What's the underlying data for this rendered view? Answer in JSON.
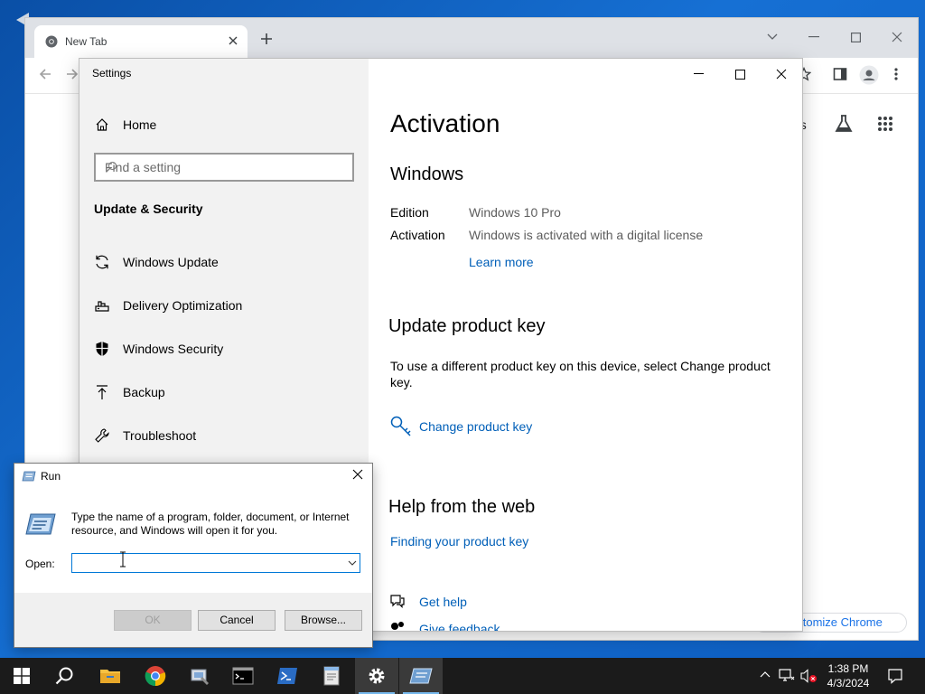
{
  "chrome": {
    "tab_title": "New Tab",
    "ntp_shortcut_fragment": "es",
    "customize_label": "ustomize Chrome"
  },
  "settings": {
    "window_title": "Settings",
    "home_label": "Home",
    "search_placeholder": "Find a setting",
    "group_title": "Update & Security",
    "nav_items": [
      {
        "label": "Windows Update",
        "icon": "refresh-icon"
      },
      {
        "label": "Delivery Optimization",
        "icon": "delivery-icon"
      },
      {
        "label": "Windows Security",
        "icon": "shield-icon"
      },
      {
        "label": "Backup",
        "icon": "backup-icon"
      },
      {
        "label": "Troubleshoot",
        "icon": "wrench-icon"
      }
    ],
    "page_title": "Activation",
    "windows_heading": "Windows",
    "edition_label": "Edition",
    "edition_value": "Windows 10 Pro",
    "activation_label": "Activation",
    "activation_value": "Windows is activated with a digital license",
    "learn_more": "Learn more",
    "update_key_heading": "Update product key",
    "update_key_text": "To use a different product key on this device, select Change product key.",
    "change_key_link": "Change product key",
    "help_heading": "Help from the web",
    "finding_key_link": "Finding your product key",
    "get_help": "Get help",
    "give_feedback": "Give feedback"
  },
  "run": {
    "title": "Run",
    "description": "Type the name of a program, folder, document, or Internet resource, and Windows will open it for you.",
    "open_label": "Open:",
    "open_value": "",
    "ok": "OK",
    "cancel": "Cancel",
    "browse": "Browse..."
  },
  "taskbar": {
    "time": "1:38 PM",
    "date": "4/3/2024"
  },
  "colors": {
    "link": "#005fb8",
    "taskbar": "#1b1b1b",
    "accent": "#0078d7"
  }
}
